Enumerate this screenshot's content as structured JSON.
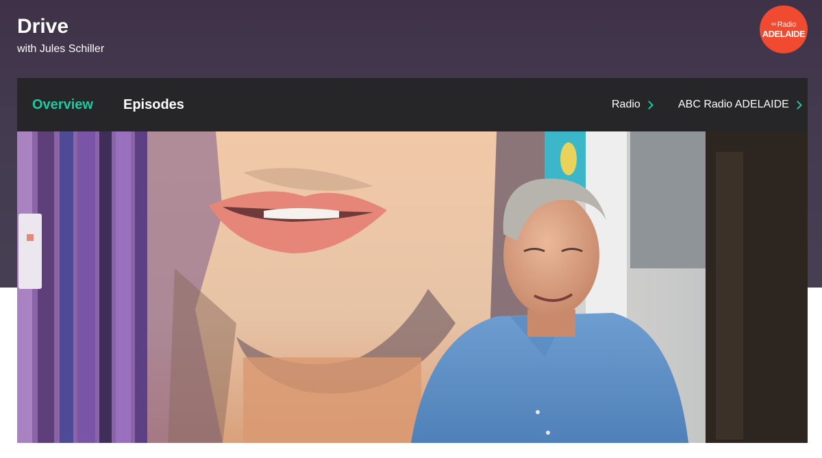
{
  "program": {
    "title": "Drive",
    "subtitle": "with Jules Schiller"
  },
  "logo": {
    "line1": "Radio",
    "line2": "ADELAIDE",
    "color": "#f04a31"
  },
  "nav": {
    "tabs": [
      {
        "label": "Overview",
        "active": true
      },
      {
        "label": "Episodes",
        "active": false
      }
    ],
    "breadcrumbs": [
      {
        "label": "Radio"
      },
      {
        "label": "ABC Radio ADELAIDE"
      }
    ]
  },
  "hero": {
    "description": "Presenter photo in front of a colourful street-art mural"
  },
  "colors": {
    "header_bg": "#433a4f",
    "nav_bg": "#262528",
    "accent": "#1fc9a3"
  }
}
